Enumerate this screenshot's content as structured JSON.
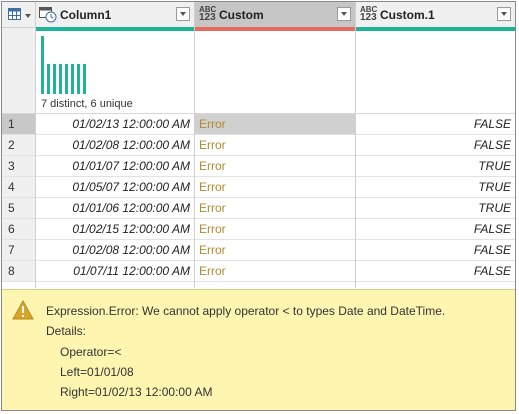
{
  "columns": [
    {
      "title": "Column1",
      "type_icon": "calendar-clock-icon"
    },
    {
      "title": "Custom",
      "type_icon": "abc-123-icon",
      "type_text_top": "ABC",
      "type_text_bottom": "123"
    },
    {
      "title": "Custom.1",
      "type_icon": "abc-123-icon",
      "type_text_top": "ABC",
      "type_text_bottom": "123"
    }
  ],
  "profile": {
    "distinct_text": "7 distinct, 6 unique",
    "histogram_bar_count": 8
  },
  "rows": [
    {
      "index": "1",
      "column1": "01/02/13 12:00:00 AM",
      "custom": "Error",
      "custom1": "FALSE"
    },
    {
      "index": "2",
      "column1": "01/02/08 12:00:00 AM",
      "custom": "Error",
      "custom1": "FALSE"
    },
    {
      "index": "3",
      "column1": "01/01/07 12:00:00 AM",
      "custom": "Error",
      "custom1": "TRUE"
    },
    {
      "index": "4",
      "column1": "01/05/07 12:00:00 AM",
      "custom": "Error",
      "custom1": "TRUE"
    },
    {
      "index": "5",
      "column1": "01/01/06 12:00:00 AM",
      "custom": "Error",
      "custom1": "TRUE"
    },
    {
      "index": "6",
      "column1": "01/02/15 12:00:00 AM",
      "custom": "Error",
      "custom1": "FALSE"
    },
    {
      "index": "7",
      "column1": "01/02/08 12:00:00 AM",
      "custom": "Error",
      "custom1": "FALSE"
    },
    {
      "index": "8",
      "column1": "01/07/11 12:00:00 AM",
      "custom": "Error",
      "custom1": "FALSE"
    }
  ],
  "error": {
    "message": "Expression.Error: We cannot apply operator < to types Date and DateTime.",
    "details_label": "Details:",
    "operator": "Operator=<",
    "left": "Left=01/01/08",
    "right": "Right=01/02/13 12:00:00 AM"
  },
  "colors": {
    "quality_ok": "#1fb39a",
    "quality_error": "#e8695e",
    "error_text": "#b08a30",
    "error_panel": "#fdf5b0"
  }
}
